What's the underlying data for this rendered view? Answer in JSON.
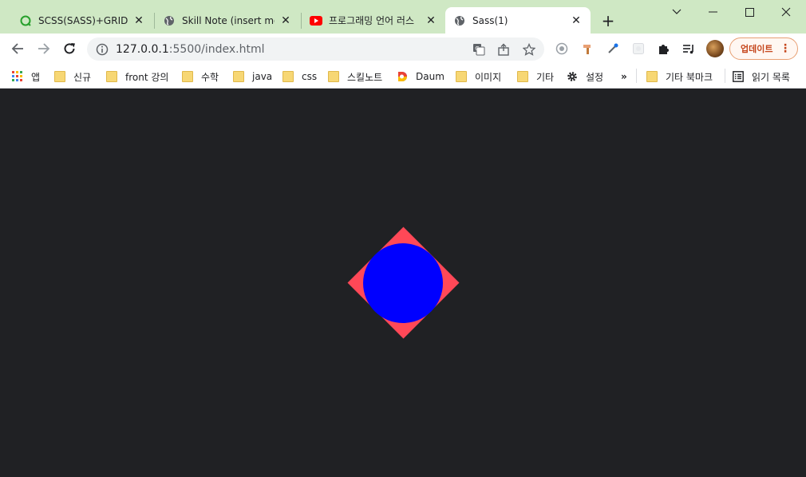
{
  "tabs": [
    {
      "title": "SCSS(SASS)+GRID+FL",
      "icon": "green-circle-icon"
    },
    {
      "title": "Skill Note (insert mod",
      "icon": "globe-icon"
    },
    {
      "title": "프로그래밍 언어 러스",
      "icon": "youtube-icon"
    },
    {
      "title": "Sass(1)",
      "icon": "globe-icon",
      "active": true
    }
  ],
  "address_bar": {
    "url_host": "127.0.0.1",
    "url_rest": ":5500/index.html"
  },
  "update_button": {
    "label": "업데이트"
  },
  "bookmarks": [
    {
      "label": "앱",
      "icon": "apps-grid-icon"
    },
    {
      "label": "신규",
      "icon": "folder-icon"
    },
    {
      "label": "front 강의",
      "icon": "folder-icon"
    },
    {
      "label": "수학",
      "icon": "folder-icon"
    },
    {
      "label": "java",
      "icon": "folder-icon"
    },
    {
      "label": "css",
      "icon": "folder-icon"
    },
    {
      "label": "스킬노트",
      "icon": "folder-icon"
    },
    {
      "label": "Daum",
      "icon": "daum-logo-icon"
    },
    {
      "label": "이미지",
      "icon": "folder-icon"
    },
    {
      "label": "기타",
      "icon": "folder-icon"
    },
    {
      "label": "설정",
      "icon": "gear-icon"
    },
    {
      "label": "»",
      "icon": "overflow-icon"
    },
    {
      "label": "기타 북마크",
      "icon": "folder-icon"
    },
    {
      "label": "읽기 목록",
      "icon": "reading-list-icon"
    }
  ],
  "colors": {
    "tab_strip": "#cfe8c4",
    "page_background": "#202124",
    "diamond": "#ff4857",
    "circle": "#0000ff"
  }
}
